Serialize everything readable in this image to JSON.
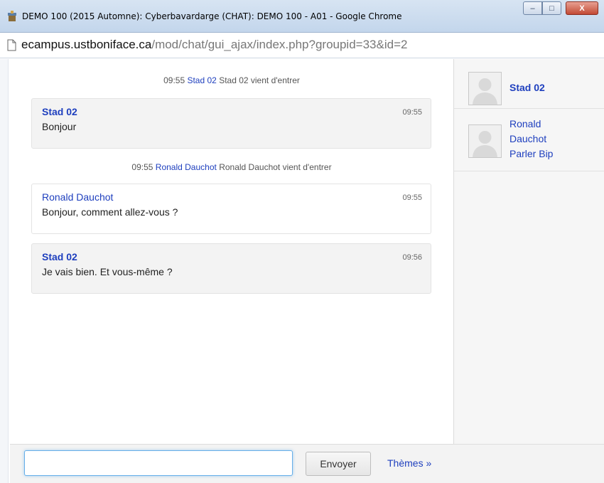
{
  "window": {
    "title": "DEMO 100 (2015 Automne): Cyberbavardarge (CHAT): DEMO 100 - A01 - Google Chrome",
    "controls": {
      "minimize": "–",
      "maximize": "□",
      "close": "X"
    }
  },
  "address": {
    "host": "ecampus.ustboniface.ca",
    "path": "/mod/chat/gui_ajax/index.php?groupid=33&id=2"
  },
  "chat": {
    "events": [
      {
        "time": "09:55",
        "who": "Stad 02",
        "text": "Stad 02 vient d'entrer"
      },
      {
        "time": "09:55",
        "who": "Ronald Dauchot",
        "text": "Ronald Dauchot vient d'entrer"
      }
    ],
    "messages": [
      {
        "author": "Stad 02",
        "time": "09:55",
        "text": "Bonjour"
      },
      {
        "author": "Ronald Dauchot",
        "time": "09:55",
        "text": "Bonjour, comment allez-vous ?"
      },
      {
        "author": "Stad 02",
        "time": "09:56",
        "text": "Je vais bien. Et vous-même ?"
      }
    ]
  },
  "users": [
    {
      "name": "Stad 02"
    },
    {
      "name_line1": "Ronald",
      "name_line2": "Dauchot",
      "action": "Parler Bip"
    }
  ],
  "composer": {
    "input_value": "",
    "send_label": "Envoyer",
    "themes_label": "Thèmes »"
  },
  "colors": {
    "link": "#1e3fbe",
    "focus": "#66afe9"
  }
}
